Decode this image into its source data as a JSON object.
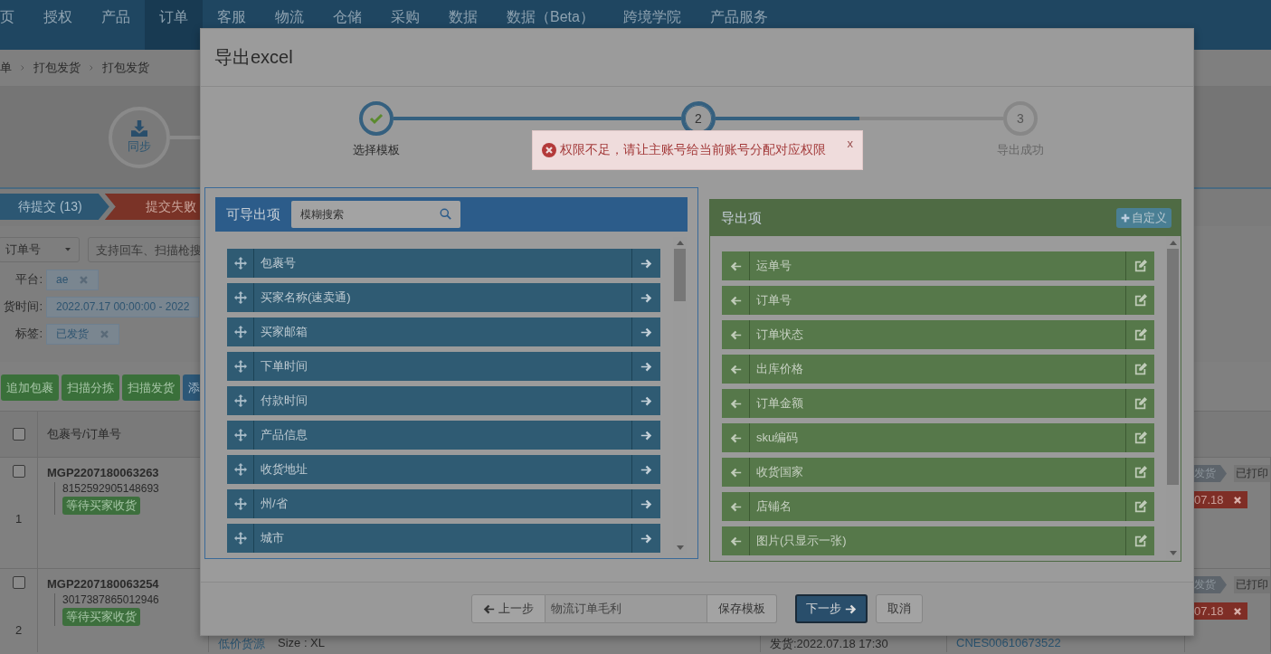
{
  "nav": {
    "items": [
      {
        "label": "页",
        "selected": false
      },
      {
        "label": "授权",
        "selected": false
      },
      {
        "label": "产品",
        "selected": false
      },
      {
        "label": "订单",
        "selected": true
      },
      {
        "label": "客服",
        "selected": false
      },
      {
        "label": "物流",
        "selected": false
      },
      {
        "label": "仓储",
        "selected": false
      },
      {
        "label": "采购",
        "selected": false
      },
      {
        "label": "数据",
        "selected": false
      },
      {
        "label": "数据（Beta）",
        "selected": false
      },
      {
        "label": "跨境学院",
        "selected": false
      },
      {
        "label": "产品服务",
        "selected": false
      }
    ]
  },
  "breadcrumb": [
    "单",
    "打包发货",
    "打包发货"
  ],
  "sync_step": {
    "label": "同步"
  },
  "status_tabs": [
    {
      "label": "待提交 (13)",
      "color": "#2c5773"
    },
    {
      "label": "提交失败",
      "color": "#7a3327"
    }
  ],
  "search": {
    "field_type": "订单号",
    "placeholder": "支持回车、扫描枪搜"
  },
  "filters": [
    {
      "label": "平台:",
      "value": "ae",
      "removable": true
    },
    {
      "label": "货时间:",
      "value": "2022.07.17 00:00:00 - 2022",
      "removable": false
    },
    {
      "label": "标签:",
      "value": "已发货",
      "removable": true
    }
  ],
  "actions": [
    {
      "label": "追加包裹",
      "color": "#3a703a"
    },
    {
      "label": "扫描分拣",
      "color": "#3a703a"
    },
    {
      "label": "扫描发货",
      "color": "#3a703a"
    },
    {
      "label": "添",
      "color": "#2c5777"
    }
  ],
  "table": {
    "select_all": {
      "checked": false
    },
    "columns": [
      "包裹号/订单号"
    ],
    "rows": [
      {
        "index": "1",
        "checked": false,
        "package_no": "MGP2207180063263",
        "order_no": "8152592905148693",
        "status": "等待买家收货",
        "tags": [
          {
            "label": "发货",
            "kind": "chevron"
          },
          {
            "label": "已打印",
            "kind": "plain"
          }
        ],
        "date_tag": "07.18"
      },
      {
        "index": "2",
        "checked": false,
        "package_no": "MGP2207180063254",
        "order_no": "3017387865012946",
        "status": "等待买家收货",
        "tags": [
          {
            "label": "发货",
            "kind": "chevron"
          },
          {
            "label": "已打印",
            "kind": "plain"
          }
        ],
        "date_tag": "07.18",
        "source": "低价货源",
        "size": "Size : XL",
        "shipped": "发货:2022.07.18 17:30",
        "tracking": "CNES00610673522"
      }
    ]
  },
  "modal": {
    "title": "导出excel",
    "steps": [
      {
        "label": "选择模板",
        "completed": true,
        "current": false
      },
      {
        "number": "2",
        "completed": false,
        "current": true
      },
      {
        "number": "3",
        "label": "导出成功",
        "completed": false,
        "current": false
      }
    ],
    "alert": {
      "message": "权限不足，请让主账号给当前账号分配对应权限",
      "close": "x"
    },
    "available": {
      "title": "可导出项",
      "search_placeholder": "模糊搜索",
      "items": [
        "包裹号",
        "买家名称(速卖通)",
        "买家邮箱",
        "下单时间",
        "付款时间",
        "产品信息",
        "收货地址",
        "州/省",
        "城市"
      ]
    },
    "selected": {
      "title": "导出项",
      "custom_button": "自定义",
      "items": [
        "运单号",
        "订单号",
        "订单状态",
        "出库价格",
        "订单金额",
        "sku编码",
        "收货国家",
        "店铺名",
        "图片(只显示一张)"
      ]
    },
    "footer": {
      "prev": "上一步",
      "template_name": "物流订单毛利",
      "save": "保存模板",
      "next": "下一步",
      "cancel": "取消"
    }
  }
}
